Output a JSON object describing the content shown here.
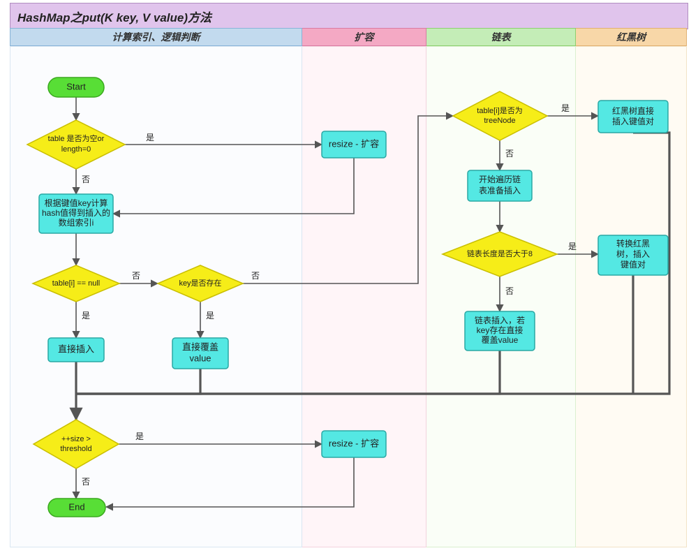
{
  "title": "HashMap之put(K key, V value)方法",
  "columns": {
    "c1": "计算索引、逻辑判断",
    "c2": "扩容",
    "c3": "链表",
    "c4": "红黑树"
  },
  "nodes": {
    "start": "Start",
    "end": "End",
    "d_table_empty_l1": "table 是否为空or",
    "d_table_empty_l2": "length=0",
    "p_resize1": "resize - 扩容",
    "p_calc_l1": "根据键值key计算",
    "p_calc_l2": "hash值得到插入的",
    "p_calc_l3": "数组索引i",
    "d_table_i_null": "table[i] == null",
    "p_direct_insert": "直接插入",
    "d_key_exists": "key是否存在",
    "p_override_l1": "直接覆盖",
    "p_override_l2": "value",
    "d_is_tree_l1": "table[i]是否为",
    "d_is_tree_l2": "treeNode",
    "p_tree_insert_l1": "红黑树直接",
    "p_tree_insert_l2": "插入键值对",
    "p_begin_list_l1": "开始遍历链",
    "p_begin_list_l2": "表准备插入",
    "d_list_len": "链表长度是否大于8",
    "p_convert_l1": "转换红黑",
    "p_convert_l2": "树，插入",
    "p_convert_l3": "键值对",
    "p_list_insert_l1": "链表插入，若",
    "p_list_insert_l2": "key存在直接",
    "p_list_insert_l3": "覆盖value",
    "d_size_l1": "++size >",
    "d_size_l2": "threshold",
    "p_resize2": "resize - 扩容"
  },
  "edge_labels": {
    "yes": "是",
    "no": "否"
  }
}
